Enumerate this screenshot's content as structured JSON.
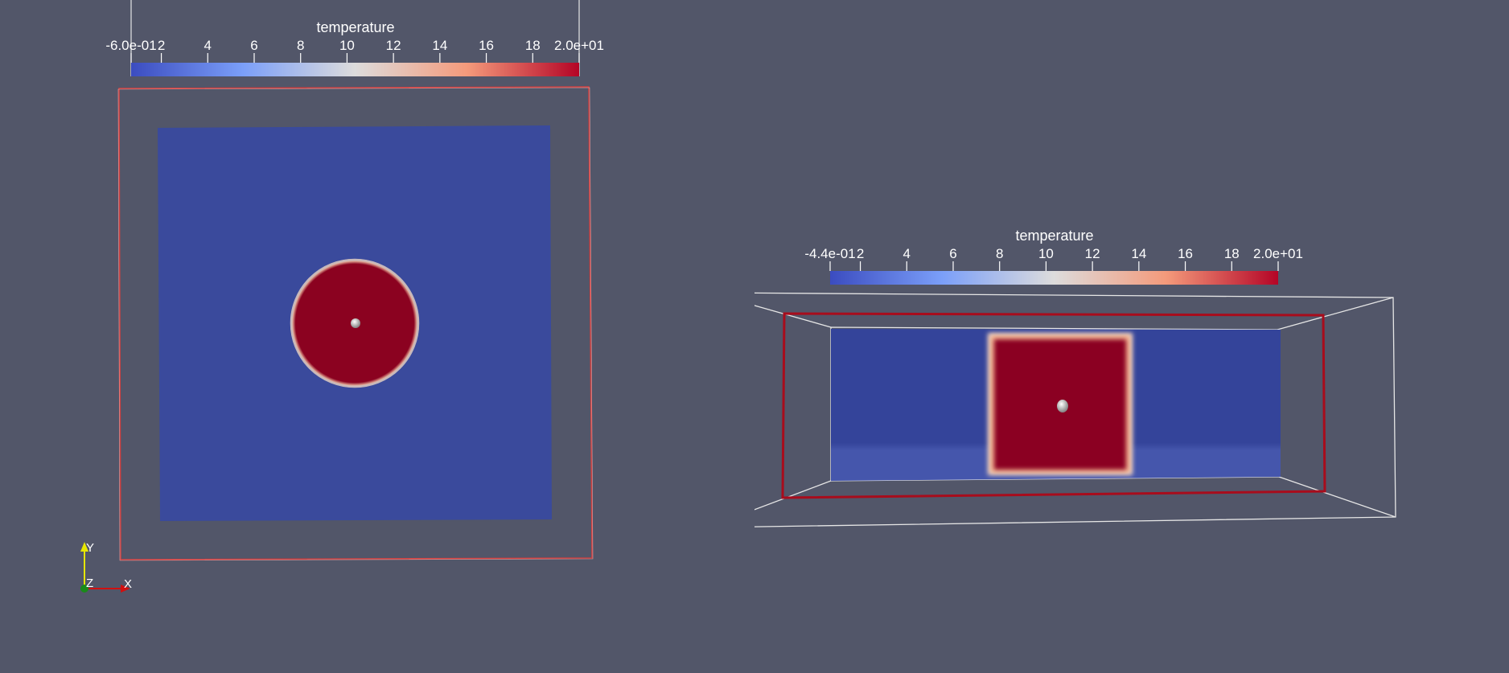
{
  "colors": {
    "background": "#525669",
    "slice_low": "#3b4ba0",
    "slice_high": "#8b0220",
    "bbox_red": "#b0101e",
    "bbox_white": "#e6e6e6",
    "axis_x": "#d01010",
    "axis_y": "#e6e600",
    "axis_z": "#1a8a1a"
  },
  "left_view": {
    "colorbar": {
      "title": "temperature",
      "labels": [
        "-6.0e-01",
        "2",
        "4",
        "6",
        "8",
        "10",
        "12",
        "14",
        "16",
        "18",
        "2.0e+01"
      ]
    },
    "orientation_axes": {
      "x_label": "X",
      "y_label": "Y",
      "z_label": "Z"
    }
  },
  "right_view": {
    "colorbar": {
      "title": "temperature",
      "labels": [
        "-4.4e-01",
        "2",
        "4",
        "6",
        "8",
        "10",
        "12",
        "14",
        "16",
        "18",
        "2.0e+01"
      ]
    }
  }
}
